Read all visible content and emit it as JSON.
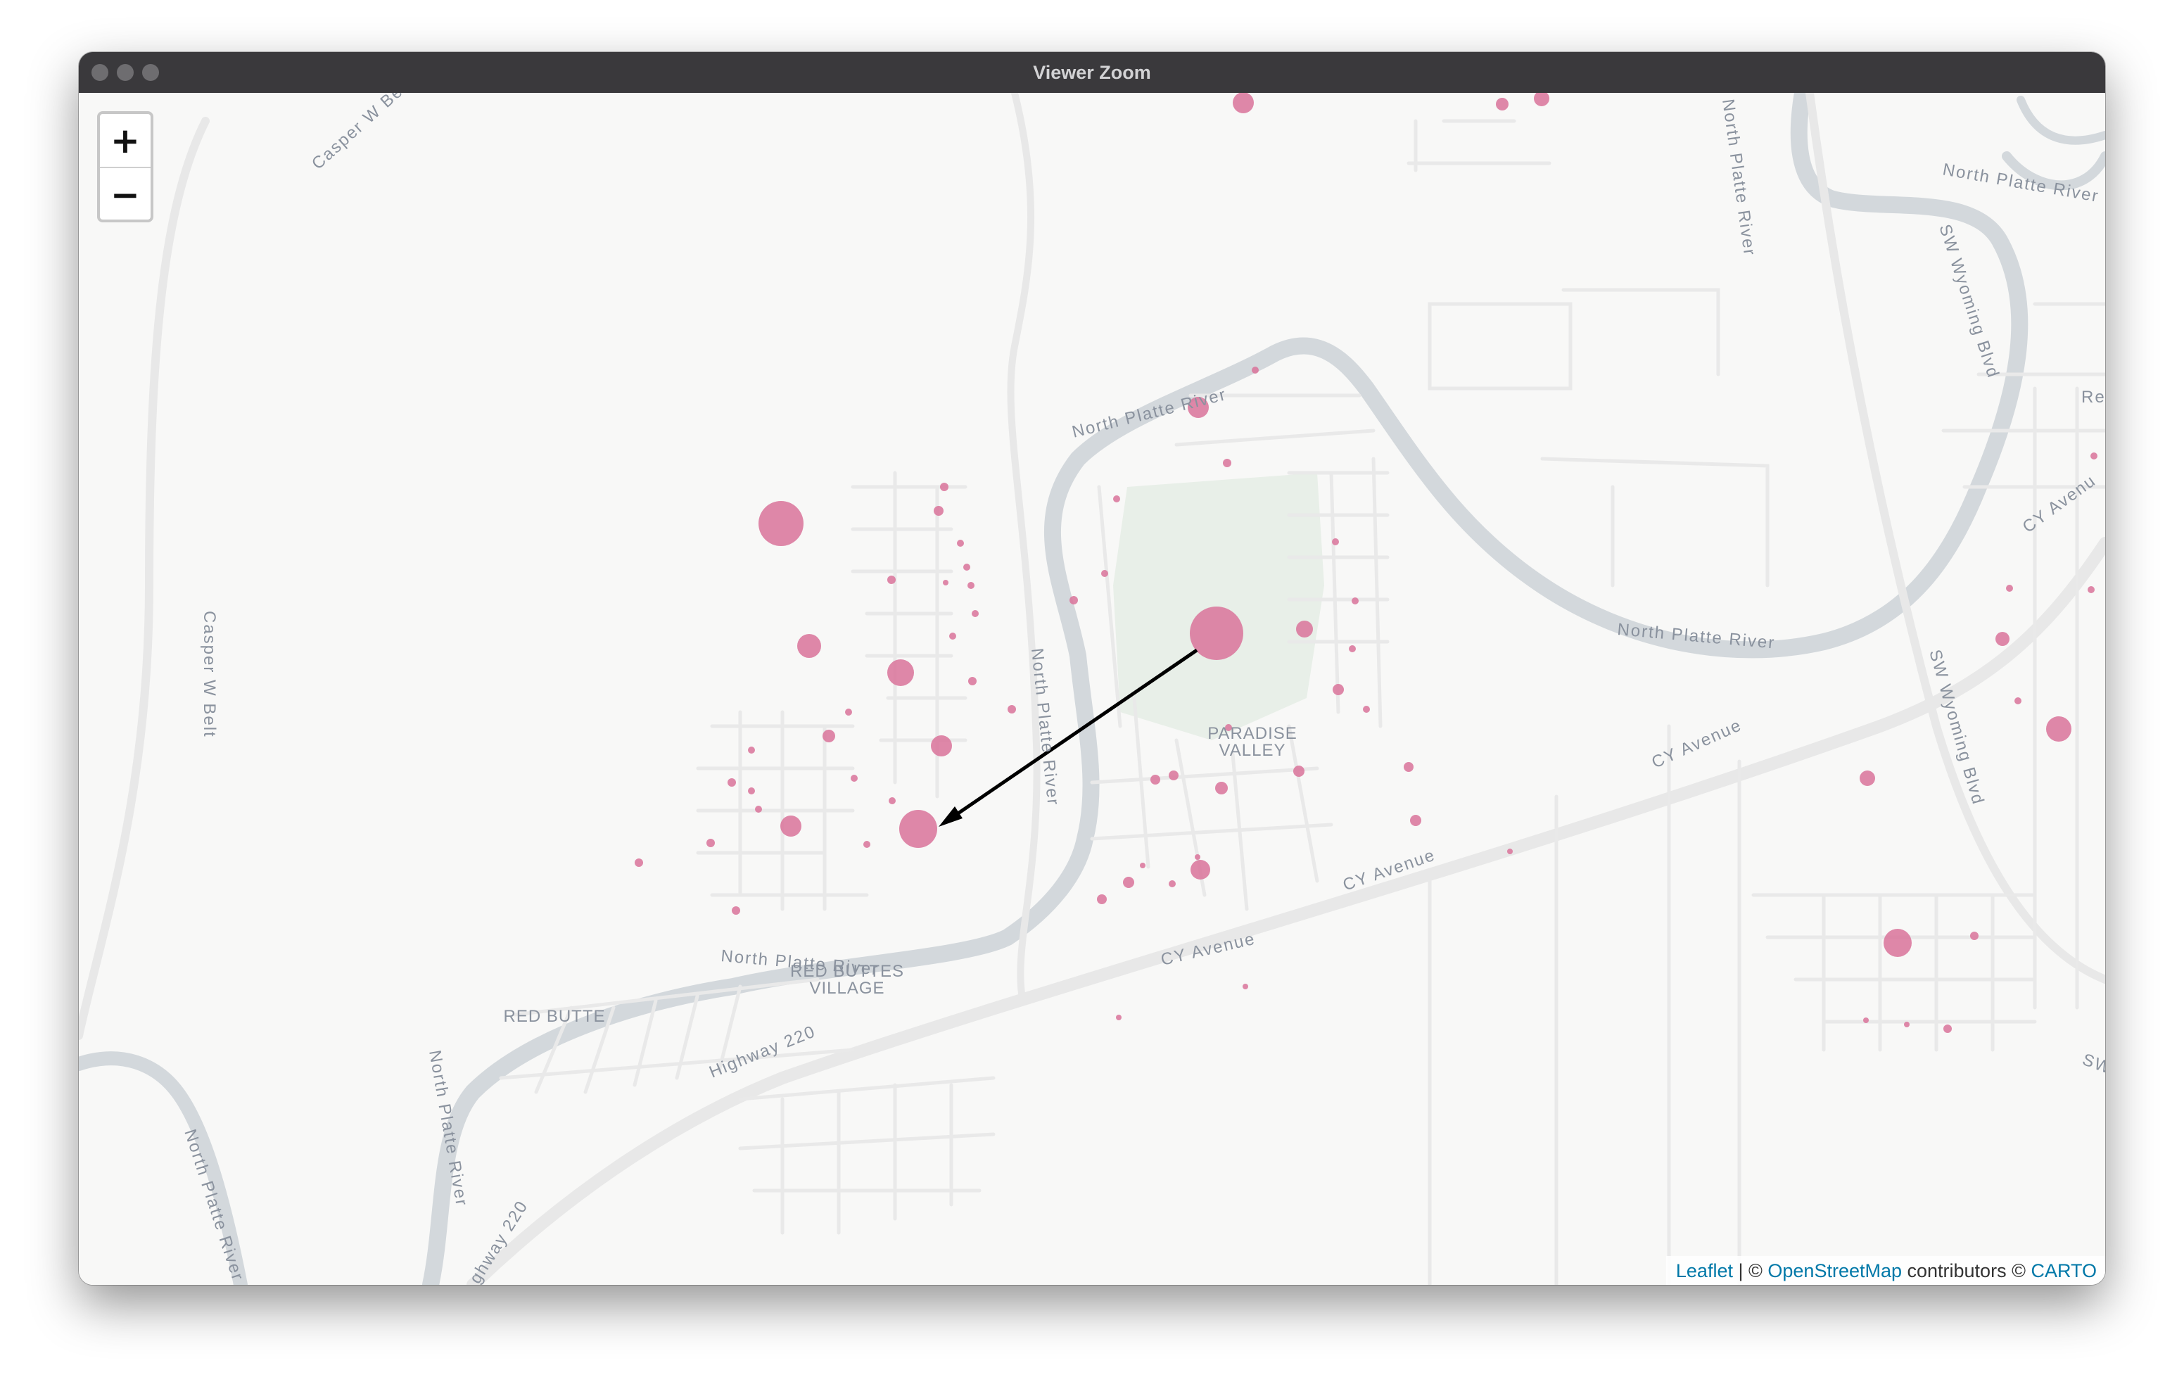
{
  "window": {
    "title": "Viewer Zoom"
  },
  "zoom_control": {
    "zoom_in": "+",
    "zoom_out": "−"
  },
  "attribution": {
    "leaflet": "Leaflet",
    "separator": " | © ",
    "osm": "OpenStreetMap",
    "contributors": " contributors © ",
    "carto": "CARTO"
  },
  "map_labels": {
    "paradise_valley_1": "PARADISE",
    "paradise_valley_2": "VALLEY",
    "red_buttes_village_1": "RED BUTTES",
    "red_buttes_village_2": "VILLAGE",
    "red_butte": "RED BUTTE",
    "cy_avenue_1": "CY Avenue",
    "cy_avenue_2": "CY Avenue",
    "cy_avenue_3": "CY Avenue",
    "cy_avenue_4": "CY Avenu",
    "highway_220_1": "Highway 220",
    "highway_220_2": "ghway 220",
    "casper_w_belt_1": "Casper W Belt",
    "casper_w_belt_2": "Casper W Belt",
    "north_platte_river_1": "North Platte River",
    "north_platte_river_2": "North Platte River",
    "north_platte_river_3": "North Platte River",
    "north_platte_river_4": "North Platte River",
    "north_platte_river_5": "North Platte River",
    "north_platte_river_6": "North Platte River",
    "north_platte_river_7": "North Platte River",
    "north_platte_river_8": "North Platte River",
    "sw_wyoming_blvd_1": "SW Wyoming Blvd",
    "sw_wyoming_blvd_2": "SW Wyoming Blvd",
    "sw_fragment": "SW",
    "re_fragment": "Re"
  },
  "colors": {
    "marker_fill": "#d9739a",
    "river": "#d3d8dc",
    "road": "#e8e8e8",
    "park": "#e8efe8",
    "arrow": "#000000",
    "link": "#0078a8"
  },
  "arrow": {
    "from": "large-marker-paradise-valley",
    "to": "marker-west-neighborhood"
  },
  "icons": {
    "zoom_in": "plus-icon",
    "zoom_out": "minus-icon",
    "arrow_head": "arrowhead-icon"
  }
}
